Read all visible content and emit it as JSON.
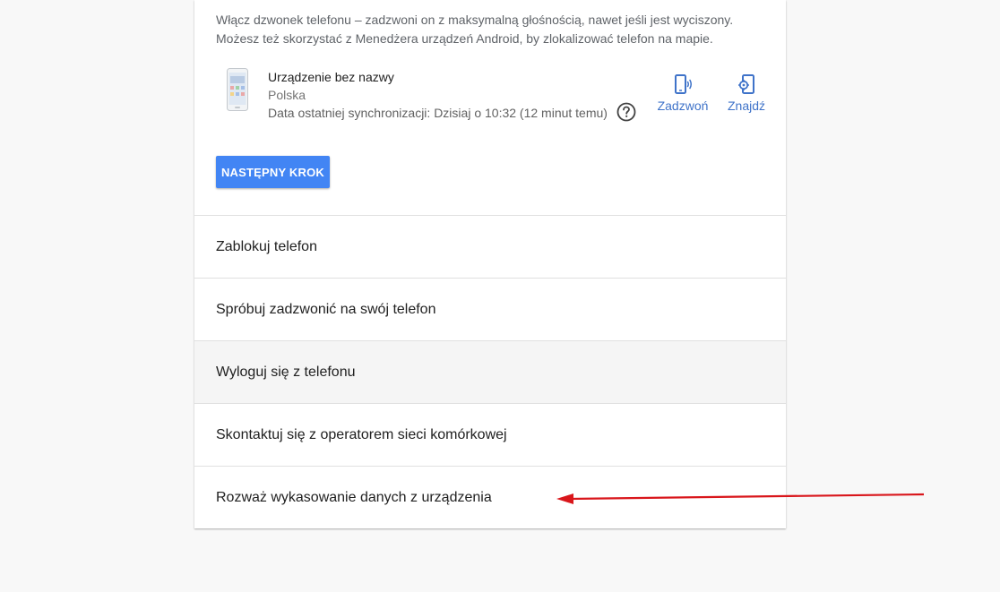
{
  "step": {
    "description_lines": [
      "Włącz dzwonek telefonu – zadzwoni on z maksymalną głośnością, nawet jeśli jest wyciszony.",
      "Możesz też skorzystać z Menedżera urządzeń Android, by zlokalizować telefon na mapie."
    ],
    "device": {
      "name": "Urządzenie bez nazwy",
      "country": "Polska",
      "last_sync": "Data ostatniej synchronizacji: Dzisiaj o 10:32 (12 minut temu)",
      "thumbnail_icon": "phone-thumbnail",
      "help_icon": "help-circle-icon"
    },
    "actions": {
      "call_label": "Zadzwoń",
      "call_icon": "phone-ring-icon",
      "find_label": "Znajdź",
      "find_icon": "phone-locate-icon"
    },
    "next_button_label": "NASTĘPNY KROK"
  },
  "options": [
    {
      "label": "Zablokuj telefon"
    },
    {
      "label": "Spróbuj zadzwonić na swój telefon"
    },
    {
      "label": "Wyloguj się z telefonu",
      "hovered": true
    },
    {
      "label": "Skontaktuj się z operatorem sieci komórkowej"
    },
    {
      "label": "Rozważ wykasowanie danych z urządzenia"
    }
  ],
  "colors": {
    "accent": "#4285f4",
    "action_link": "#3f73c9",
    "annotation_arrow": "#d9161b",
    "page_background": "#f8f8f8"
  }
}
